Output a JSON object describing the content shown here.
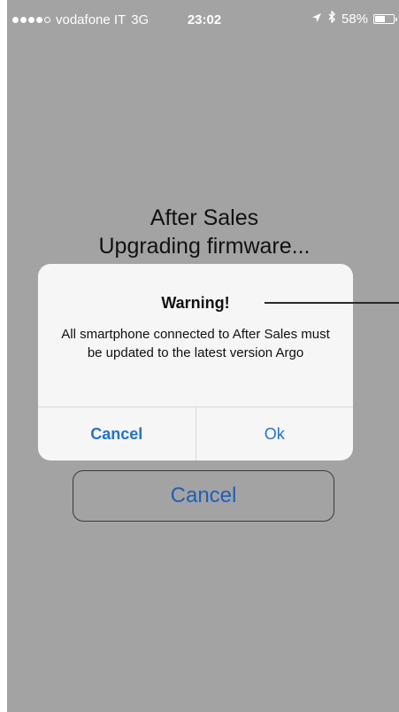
{
  "colors": {
    "background": "#a3a3a3",
    "primary_text": "#111111",
    "accent": "#1e73d8",
    "alert_bg": "#f6f6f6"
  },
  "status_bar": {
    "carrier": "vodafone IT",
    "network": "3G",
    "time": "23:02",
    "battery": "58%",
    "battery_level": 0.58,
    "icons": [
      "signal-dots-icon",
      "location-arrow-icon",
      "bluetooth-icon",
      "battery-icon"
    ]
  },
  "screen": {
    "title_line1": "After Sales",
    "title_line2": "Upgrading firmware...",
    "cancel_button_label": "Cancel"
  },
  "alert": {
    "title": "Warning!",
    "message": "All smartphone connected to After Sales must be updated to the latest version Argo",
    "cancel_label": "Cancel",
    "ok_label": "Ok"
  }
}
